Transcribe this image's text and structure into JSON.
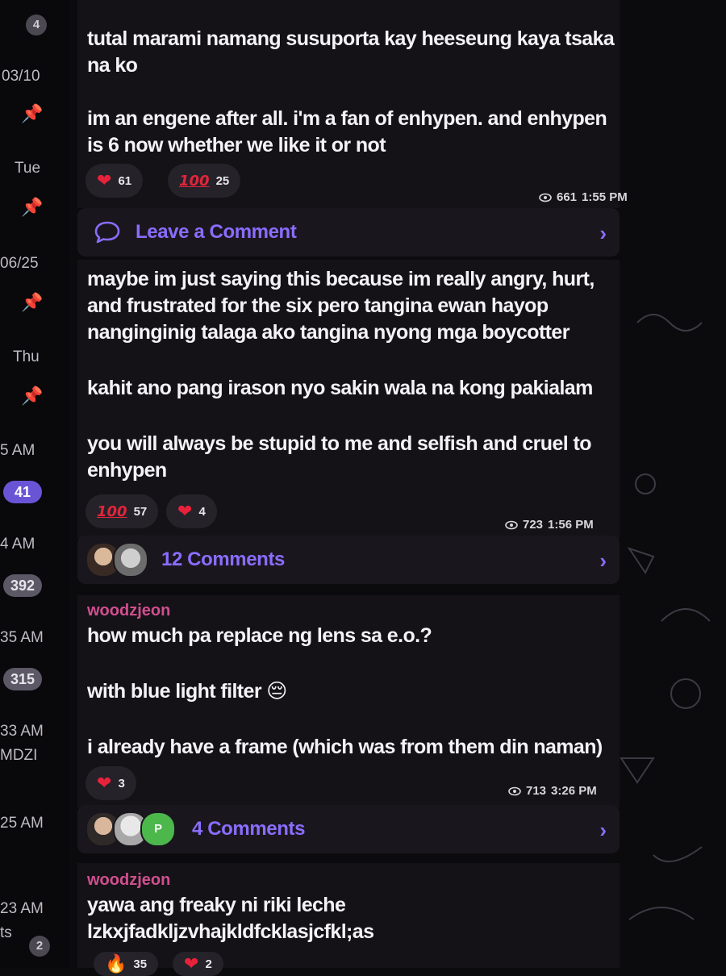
{
  "sidebar": {
    "top_badge": "4",
    "dates": [
      "03/10",
      "Tue",
      "06/25",
      "Thu"
    ],
    "times": [
      "5 AM",
      "4 AM",
      "35 AM",
      "33 AM",
      "25 AM",
      "23 AM"
    ],
    "sub_text": [
      "MDZI",
      "ts"
    ],
    "unread_counts": [
      "41",
      "392",
      "315"
    ],
    "bottom_badge": "2"
  },
  "messages": [
    {
      "text_lines": [
        "tutal marami namang susuporta kay heeseung kaya tsaka",
        "na ko",
        "",
        "im an engene after all. i'm a fan of enhypen. and enhypen",
        "is 6 now whether we like it or not"
      ],
      "reactions": [
        {
          "icon": "heart",
          "count": "61"
        },
        {
          "icon": "hundred",
          "count": "25"
        }
      ],
      "views": "661",
      "time": "1:55 PM",
      "comment_label": "Leave a Comment"
    },
    {
      "text_lines": [
        "maybe im just saying this because im really angry, hurt,",
        "and frustrated for the six pero tangina ewan hayop",
        "nanginginig talaga ako tangina nyong mga boycotter",
        "",
        "kahit ano pang irason nyo sakin wala na kong pakialam",
        "",
        "you will always be stupid to me and selfish and cruel to",
        "enhypen"
      ],
      "reactions": [
        {
          "icon": "hundred",
          "count": "57"
        },
        {
          "icon": "heart",
          "count": "4"
        }
      ],
      "views": "723",
      "time": "1:56 PM",
      "comment_label": "12 Comments"
    },
    {
      "author": "woodzjeon",
      "text_lines": [
        "how much pa replace ng lens sa e.o.?",
        "",
        "with blue light filter 😔",
        "",
        "i already have a frame (which was from them din naman)"
      ],
      "reactions": [
        {
          "icon": "heart",
          "count": "3"
        }
      ],
      "views": "713",
      "time": "3:26 PM",
      "comment_label": "4 Comments"
    },
    {
      "author": "woodzjeon",
      "text_lines": [
        "yawa ang freaky ni riki leche",
        "lzkxjfadkljzvhajkldfcklasjcfkl;as"
      ],
      "reactions": [
        {
          "icon": "fire",
          "count": "35"
        },
        {
          "icon": "heart",
          "count": "2"
        }
      ]
    }
  ],
  "colors": {
    "accent": "#8a6dff",
    "author": "#d14f8f",
    "unread_badge": "#6a54d6",
    "heart": "#e8223a"
  },
  "avatar_initial": "P"
}
